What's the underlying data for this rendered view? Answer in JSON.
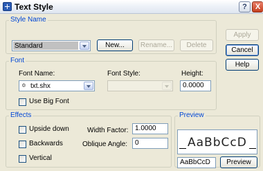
{
  "window": {
    "title": "Text Style",
    "help_glyph": "?",
    "close_glyph": "X"
  },
  "style_name": {
    "legend": "Style Name",
    "selected": "Standard",
    "new_label": "New...",
    "rename_label": "Rename...",
    "delete_label": "Delete"
  },
  "actions": {
    "apply": "Apply",
    "cancel": "Cancel",
    "help": "Help"
  },
  "font": {
    "legend": "Font",
    "font_name_label": "Font Name:",
    "font_name_value": "txt.shx",
    "font_style_label": "Font Style:",
    "font_style_value": "",
    "height_label": "Height:",
    "height_value": "0.0000",
    "big_font_label": "Use Big Font"
  },
  "effects": {
    "legend": "Effects",
    "upside_down_label": "Upside down",
    "backwards_label": "Backwards",
    "vertical_label": "Vertical",
    "width_factor_label": "Width Factor:",
    "width_factor_value": "1.0000",
    "oblique_label": "Oblique Angle:",
    "oblique_value": "0"
  },
  "preview": {
    "legend": "Preview",
    "sample": "AaBbCcD",
    "input_value": "AaBbCcD",
    "button_label": "Preview"
  },
  "colors": {
    "title_blue": "#0046d5",
    "dialog_bg": "#ece9d8",
    "border_blue": "#7f9db9"
  }
}
